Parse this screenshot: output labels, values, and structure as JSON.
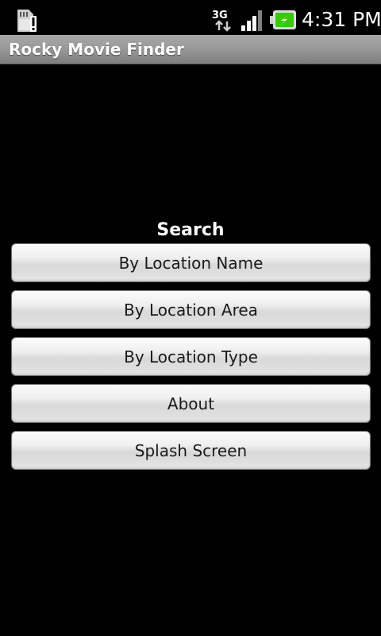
{
  "status_bar": {
    "time": "4:31 PM",
    "network_label": "3G",
    "icons": [
      "sd-card-warning-icon",
      "network-3g-icon",
      "signal-strength-icon",
      "battery-charging-icon"
    ]
  },
  "app": {
    "title": "Rocky Movie Finder"
  },
  "search": {
    "heading": "Search",
    "buttons": [
      {
        "label": "By Location Name"
      },
      {
        "label": "By Location Area"
      },
      {
        "label": "By Location Type"
      },
      {
        "label": "About"
      },
      {
        "label": "Splash Screen"
      }
    ]
  },
  "colors": {
    "background": "#000000",
    "title_bar": "#9a9a9a",
    "button_face": "#e8e8e8",
    "button_text": "#1a1a1a",
    "battery_green": "#33cc00"
  }
}
